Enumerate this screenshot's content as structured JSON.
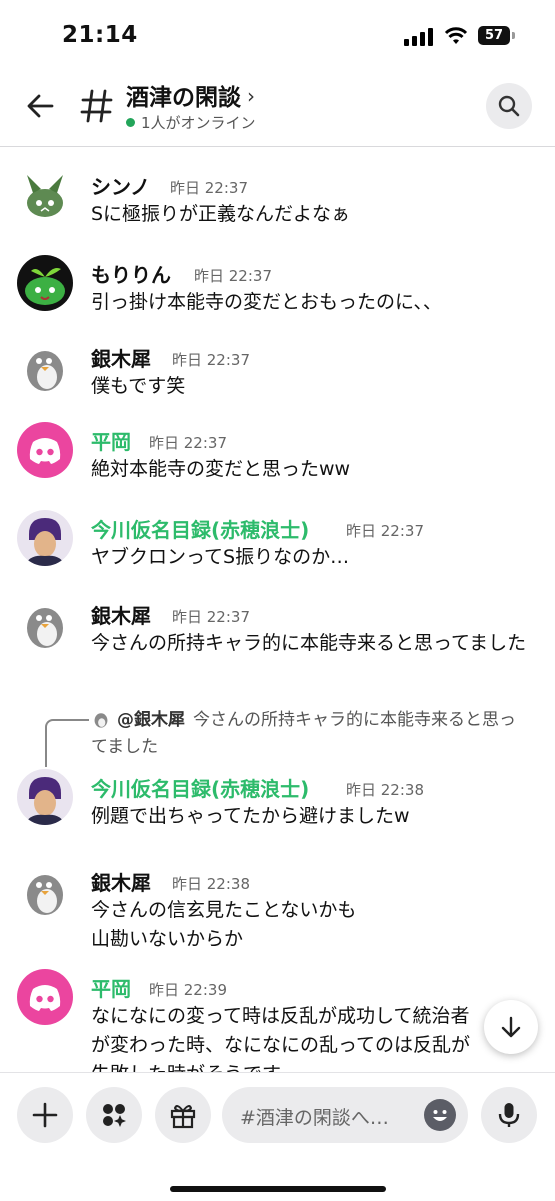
{
  "status": {
    "time": "21:14",
    "battery": "57"
  },
  "header": {
    "title": "酒津の閑談",
    "online": "1人がオンライン"
  },
  "messages": [
    {
      "name": "シンノ",
      "time": "昨日 22:37",
      "text": "Sに極振りが正義なんだよなぁ"
    },
    {
      "name": "もりりん",
      "time": "昨日 22:37",
      "text": "引っ掛け本能寺の変だとおもったのに、、"
    },
    {
      "name": "銀木犀",
      "time": "昨日 22:37",
      "text": "僕もです笑"
    },
    {
      "name": "平岡",
      "time": "昨日 22:37",
      "text": "絶対本能寺の変だと思ったww"
    },
    {
      "name": "今川仮名目録(赤穂浪士)",
      "time": "昨日 22:37",
      "text": "ヤブクロンってS振りなのか…"
    },
    {
      "name": "銀木犀",
      "time": "昨日 22:37",
      "text": "今さんの所持キャラ的に本能寺来ると思ってました"
    },
    {
      "reply_name": "@銀木犀",
      "reply_text": "今さんの所持キャラ的に本能寺来ると思ってました",
      "name": "今川仮名目録(赤穂浪士)",
      "time": "昨日 22:38",
      "text": "例題で出ちゃってたから避けましたw"
    },
    {
      "name": "銀木犀",
      "time": "昨日 22:38",
      "text": "今さんの信玄見たことないかも\n山勘いないからか"
    },
    {
      "name": "平岡",
      "time": "昨日 22:39",
      "text": "なになにの変って時は反乱が成功して統治者が変わった時、なになにの乱ってのは反乱が失敗した時がそうです"
    }
  ],
  "composer": {
    "placeholder": "#酒津の閑談へ…"
  },
  "colors": {
    "online": "#23a55a",
    "role_green": "#2dbb6b",
    "discord_pink": "#eb459f"
  },
  "icons": [
    "back-arrow-icon",
    "hash-icon",
    "search-icon",
    "plus-icon",
    "apps-icon",
    "gift-icon",
    "emoji-icon",
    "mic-icon",
    "arrow-down-icon"
  ]
}
